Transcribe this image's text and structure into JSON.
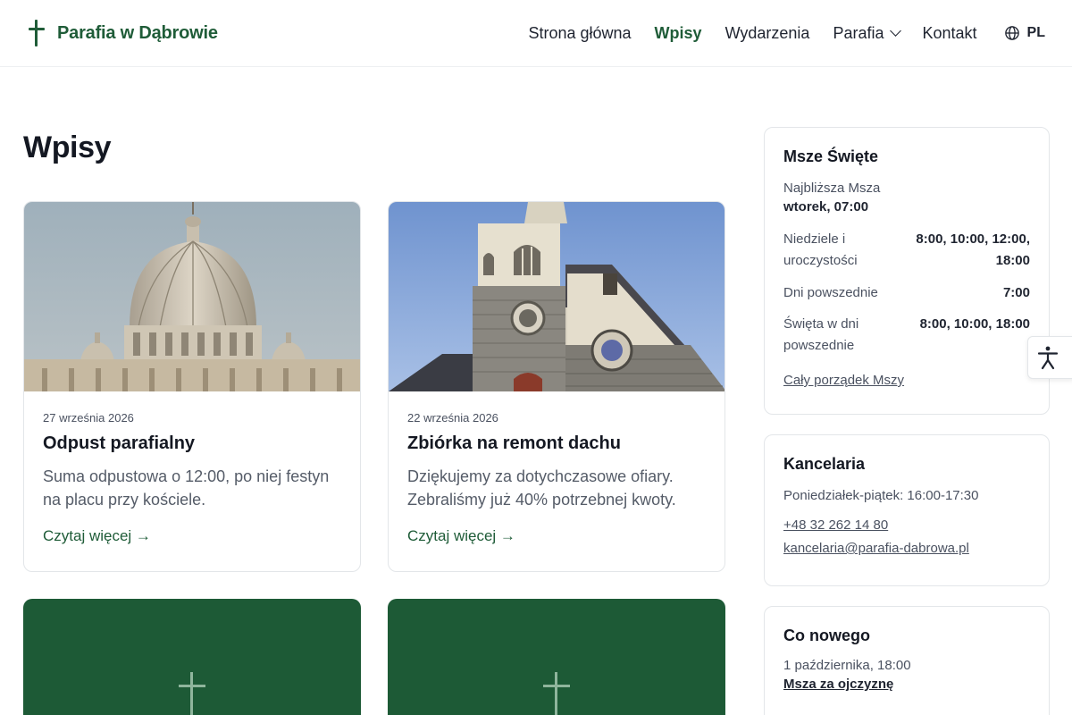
{
  "header": {
    "brand": "Parafia w Dąbrowie",
    "nav": [
      "Strona główna",
      "Wpisy",
      "Wydarzenia",
      "Parafia",
      "Kontakt"
    ],
    "active_nav": "Wpisy",
    "lang": "PL"
  },
  "main": {
    "title": "Wpisy",
    "posts": [
      {
        "date": "27 września 2026",
        "title": "Odpust parafialny",
        "excerpt": "Suma odpustowa o 12:00, po niej festyn na placu przy kościele.",
        "link": "Czytaj więcej →"
      },
      {
        "date": "22 września 2026",
        "title": "Zbiórka na remont dachu",
        "excerpt": "Dziękujemy za dotychczasowe ofiary. Zebraliśmy już 40% potrzebnej kwoty.",
        "link": "Czytaj więcej →"
      }
    ]
  },
  "sidebar": {
    "masses": {
      "title": "Msze Święte",
      "next_label": "Najbliższa Msza",
      "next_value": "wtorek, 07:00",
      "schedule": [
        {
          "label": "Niedziele i uroczystości",
          "value": "8:00, 10:00, 12:00, 18:00"
        },
        {
          "label": "Dni powszednie",
          "value": "7:00"
        },
        {
          "label": "Święta w dni powszednie",
          "value": "8:00, 10:00, 18:00"
        }
      ],
      "link": "Cały porządek Mszy"
    },
    "office": {
      "title": "Kancelaria",
      "hours": "Poniedziałek-piątek: 16:00-17:30",
      "phone": "+48 32 262 14 80",
      "email": "kancelaria@parafia-dabrowa.pl"
    },
    "news": {
      "title": "Co nowego",
      "items": [
        {
          "when": "1 października, 18:00",
          "title": "Msza za ojczyznę"
        }
      ]
    }
  },
  "colors": {
    "brand_green": "#1f5c38",
    "card_green": "#1d5a36"
  },
  "icons": [
    "cross-icon",
    "chevron-down-icon",
    "globe-icon",
    "accessibility-icon"
  ]
}
